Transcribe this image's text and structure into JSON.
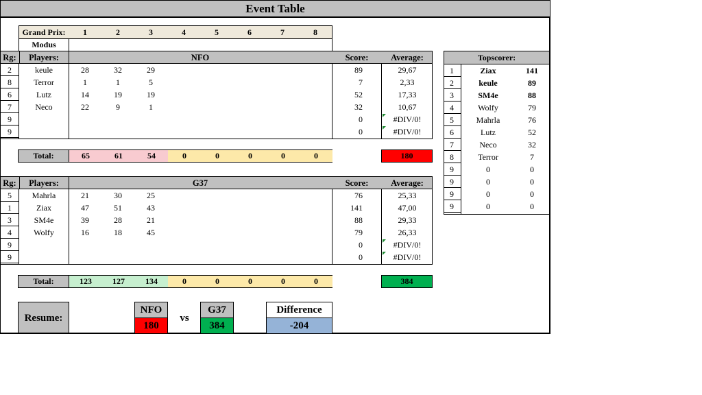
{
  "title": "Event Table",
  "grand_prix": {
    "label": "Grand Prix:",
    "numbers": [
      "1",
      "2",
      "3",
      "4",
      "5",
      "6",
      "7",
      "8"
    ],
    "modus_label": "Modus"
  },
  "headers": {
    "rank": "Rg:",
    "players": "Players:",
    "score": "Score:",
    "average": "Average:",
    "total": "Total:"
  },
  "team1": {
    "name": "NFO",
    "rows": [
      {
        "rank": "2",
        "player": "keule",
        "gp": [
          "28",
          "32",
          "29"
        ],
        "score": "89",
        "avg": "29,67"
      },
      {
        "rank": "8",
        "player": "Terror",
        "gp": [
          "1",
          "1",
          "5"
        ],
        "score": "7",
        "avg": "2,33"
      },
      {
        "rank": "6",
        "player": "Lutz",
        "gp": [
          "14",
          "19",
          "19"
        ],
        "score": "52",
        "avg": "17,33"
      },
      {
        "rank": "7",
        "player": "Neco",
        "gp": [
          "22",
          "9",
          "1"
        ],
        "score": "32",
        "avg": "10,67"
      },
      {
        "rank": "9",
        "player": "",
        "gp": [
          "",
          "",
          ""
        ],
        "score": "0",
        "avg": "#DIV/0!"
      },
      {
        "rank": "9",
        "player": "",
        "gp": [
          "",
          "",
          ""
        ],
        "score": "0",
        "avg": "#DIV/0!"
      }
    ],
    "totals": [
      "65",
      "61",
      "54",
      "0",
      "0",
      "0",
      "0",
      "0"
    ],
    "total_score": "180"
  },
  "team2": {
    "name": "G37",
    "rows": [
      {
        "rank": "5",
        "player": "Mahrla",
        "gp": [
          "21",
          "30",
          "25"
        ],
        "score": "76",
        "avg": "25,33"
      },
      {
        "rank": "1",
        "player": "Ziax",
        "gp": [
          "47",
          "51",
          "43"
        ],
        "score": "141",
        "avg": "47,00"
      },
      {
        "rank": "3",
        "player": "SM4e",
        "gp": [
          "39",
          "28",
          "21"
        ],
        "score": "88",
        "avg": "29,33"
      },
      {
        "rank": "4",
        "player": "Wolfy",
        "gp": [
          "16",
          "18",
          "45"
        ],
        "score": "79",
        "avg": "26,33"
      },
      {
        "rank": "9",
        "player": "",
        "gp": [
          "",
          "",
          ""
        ],
        "score": "0",
        "avg": "#DIV/0!"
      },
      {
        "rank": "9",
        "player": "",
        "gp": [
          "",
          "",
          ""
        ],
        "score": "0",
        "avg": "#DIV/0!"
      }
    ],
    "totals": [
      "123",
      "127",
      "134",
      "0",
      "0",
      "0",
      "0",
      "0"
    ],
    "total_score": "384"
  },
  "topscorer": {
    "title": "Topscorer:",
    "rows": [
      {
        "rank": "1",
        "name": "Ziax",
        "score": "141",
        "bold": true
      },
      {
        "rank": "2",
        "name": "keule",
        "score": "89",
        "bold": true
      },
      {
        "rank": "3",
        "name": "SM4e",
        "score": "88",
        "bold": true
      },
      {
        "rank": "4",
        "name": "Wolfy",
        "score": "79",
        "bold": false
      },
      {
        "rank": "5",
        "name": "Mahrla",
        "score": "76",
        "bold": false
      },
      {
        "rank": "6",
        "name": "Lutz",
        "score": "52",
        "bold": false
      },
      {
        "rank": "7",
        "name": "Neco",
        "score": "32",
        "bold": false
      },
      {
        "rank": "8",
        "name": "Terror",
        "score": "7",
        "bold": false
      },
      {
        "rank": "9",
        "name": "0",
        "score": "0",
        "bold": false
      },
      {
        "rank": "9",
        "name": "0",
        "score": "0",
        "bold": false
      },
      {
        "rank": "9",
        "name": "0",
        "score": "0",
        "bold": false
      },
      {
        "rank": "9",
        "name": "0",
        "score": "0",
        "bold": false
      }
    ]
  },
  "resume": {
    "label": "Resume:",
    "team1": "NFO",
    "team1_score": "180",
    "vs": "vs",
    "team2": "G37",
    "team2_score": "384",
    "difference_label": "Difference",
    "difference": "-204"
  },
  "colors": {
    "header_gray": "#c0c0c0",
    "nfo_red": "#ff0000",
    "g37_green": "#00b050",
    "diff_blue": "#95b3d7",
    "pink": "#f8cbd0",
    "yellow": "#fde9a9",
    "light_green": "#c6efcf"
  }
}
